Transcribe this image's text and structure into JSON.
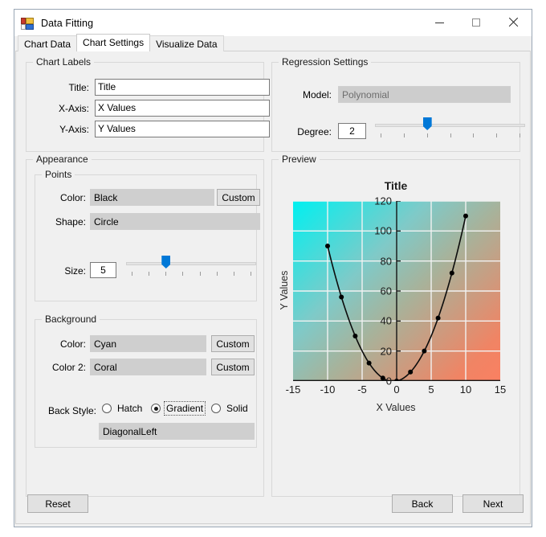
{
  "window": {
    "title": "Data Fitting",
    "icon": "winforms-app-icon",
    "controls": {
      "minimize": "minimize-icon",
      "maximize": "maximize-icon",
      "close": "close-icon"
    }
  },
  "tabs": [
    {
      "label": "Chart Data",
      "active": false
    },
    {
      "label": "Chart Settings",
      "active": true
    },
    {
      "label": "Visualize Data",
      "active": false
    }
  ],
  "chart_labels": {
    "group": "Chart Labels",
    "title_label": "Title:",
    "title_value": "Title",
    "xaxis_label": "X-Axis:",
    "xaxis_value": "X Values",
    "yaxis_label": "Y-Axis:",
    "yaxis_value": "Y Values"
  },
  "regression": {
    "group": "Regression Settings",
    "model_label": "Model:",
    "model_value": "Polynomial",
    "model_disabled": true,
    "degree_label": "Degree:",
    "degree_value": "2",
    "degree_ticks": 7,
    "degree_thumb_index": 2
  },
  "appearance": {
    "group": "Appearance",
    "points": {
      "group": "Points",
      "color_label": "Color:",
      "color_value": "Black",
      "color_custom": "Custom",
      "shape_label": "Shape:",
      "shape_value": "Circle",
      "size_label": "Size:",
      "size_value": "5",
      "size_ticks": 8,
      "size_thumb_index": 2
    },
    "background": {
      "group": "Background",
      "color_label": "Color:",
      "color_value": "Cyan",
      "color_custom": "Custom",
      "color2_label": "Color 2:",
      "color2_value": "Coral",
      "color2_custom": "Custom",
      "backstyle_label": "Back Style:",
      "options": [
        {
          "label": "Hatch",
          "checked": false,
          "focused": false
        },
        {
          "label": "Gradient",
          "checked": true,
          "focused": true
        },
        {
          "label": "Solid",
          "checked": false,
          "focused": false
        }
      ],
      "gradient_mode_value": "DiagonalLeft"
    }
  },
  "preview": {
    "group": "Preview"
  },
  "footer": {
    "reset": "Reset",
    "back": "Back",
    "next": "Next"
  },
  "colors": {
    "accent": "#0078d7",
    "gradient_start": "#00f0f0",
    "gradient_end": "#fa8062",
    "point_color": "#000000",
    "window_bg": "#f0f0f0"
  },
  "chart_data": {
    "type": "scatter",
    "title": "Title",
    "xlabel": "X Values",
    "ylabel": "Y Values",
    "xlim": [
      -15,
      15
    ],
    "ylim": [
      0,
      120
    ],
    "xticks": [
      -15,
      -10,
      -5,
      0,
      5,
      10,
      15
    ],
    "yticks": [
      0,
      20,
      40,
      60,
      80,
      100,
      120
    ],
    "grid": true,
    "legend": false,
    "point_shape": "circle",
    "point_size": 5,
    "point_color": "#000000",
    "fit_curve": "polynomial degree 2",
    "x": [
      -10,
      -8,
      -6,
      -4,
      -2,
      0,
      2,
      4,
      6,
      8,
      10
    ],
    "y": [
      90,
      56,
      30,
      12,
      2,
      0,
      6,
      20,
      42,
      72,
      110
    ],
    "background": {
      "style": "Gradient",
      "mode": "DiagonalLeft",
      "color1": "Cyan",
      "color2": "Coral"
    }
  }
}
